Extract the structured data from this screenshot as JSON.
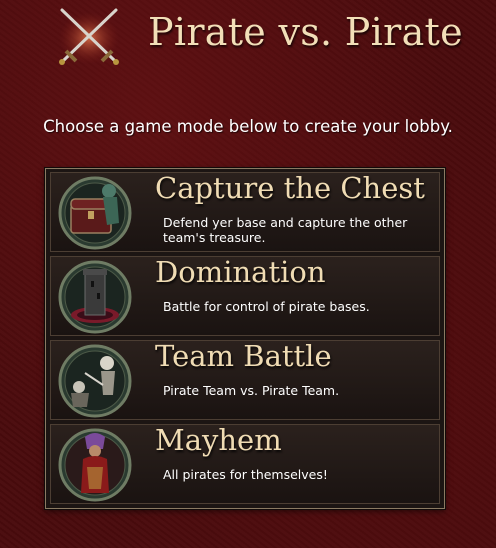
{
  "header": {
    "title": "Pirate vs. Pirate",
    "icon": "crossed-swords-icon"
  },
  "subtitle": "Choose a game mode below to create your lobby.",
  "modes": [
    {
      "name": "Capture the Chest",
      "description": "Defend yer base and capture the other team's treasure.",
      "icon": "treasure-chest-icon"
    },
    {
      "name": "Domination",
      "description": "Battle for control of pirate bases.",
      "icon": "tower-icon"
    },
    {
      "name": "Team Battle",
      "description": "Pirate Team vs. Pirate Team.",
      "icon": "skeleton-duel-icon"
    },
    {
      "name": "Mayhem",
      "description": "All pirates for themselves!",
      "icon": "pirate-figure-icon"
    }
  ],
  "colors": {
    "background": "#4a0b0d",
    "title_text": "#f2dfb8",
    "panel": "#1c1513",
    "panel_border": "#8a7a62"
  }
}
